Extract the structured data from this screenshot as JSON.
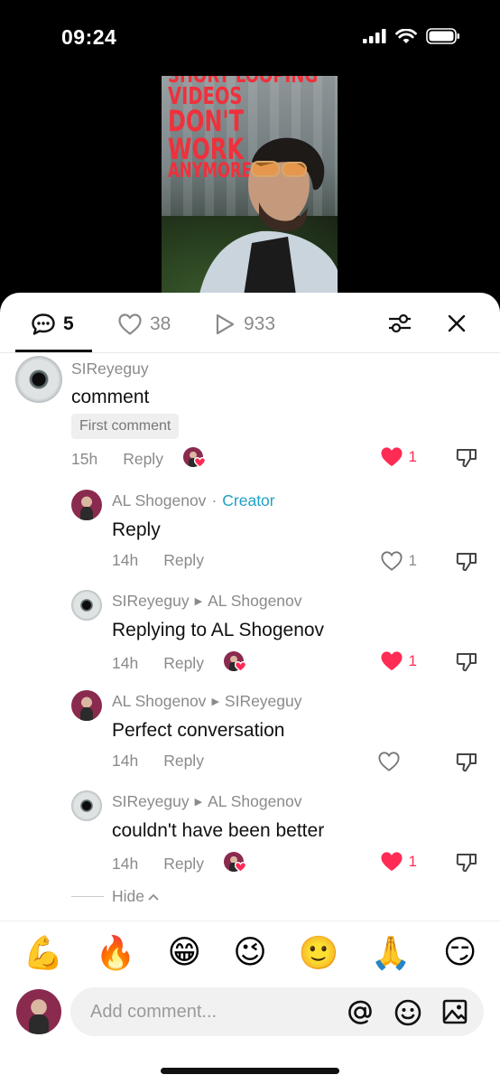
{
  "status_bar": {
    "time": "09:24"
  },
  "video": {
    "title_lines": [
      "SHORT LOOPING",
      "VIDEOS",
      "DON'T",
      "WORK",
      "ANYMORE"
    ]
  },
  "tabs": {
    "comments_count": "5",
    "likes_count": "38",
    "views_count": "933"
  },
  "comments": [
    {
      "author": "SIReyeguy",
      "body": "comment",
      "badge": "First comment",
      "time": "15h",
      "reply_label": "Reply",
      "likes": "1",
      "liked": true,
      "avatar": "eye",
      "creator_liked": true
    },
    {
      "author": "AL Shogenov",
      "creator_label": "Creator",
      "body": "Reply",
      "time": "14h",
      "reply_label": "Reply",
      "likes": "1",
      "liked": false,
      "avatar": "man"
    },
    {
      "author": "SIReyeguy",
      "reply_to": "AL Shogenov",
      "body": "Replying to AL Shogenov",
      "time": "14h",
      "reply_label": "Reply",
      "likes": "1",
      "liked": true,
      "avatar": "eye",
      "creator_liked": true
    },
    {
      "author": "AL Shogenov",
      "reply_to": "SIReyeguy",
      "body": "Perfect conversation",
      "time": "14h",
      "reply_label": "Reply",
      "likes": "",
      "liked": false,
      "avatar": "man"
    },
    {
      "author": "SIReyeguy",
      "reply_to": "AL Shogenov",
      "body": "couldn't have been better",
      "time": "14h",
      "reply_label": "Reply",
      "likes": "1",
      "liked": true,
      "avatar": "eye",
      "creator_liked": true
    }
  ],
  "hide_label": "Hide",
  "emoji_bar": [
    "💪",
    "🔥",
    "😁",
    "😉",
    "🙂",
    "🙏",
    "😏"
  ],
  "input": {
    "placeholder": "Add comment..."
  },
  "colors": {
    "accent_like": "#fe2c55",
    "creator": "#1ea1c6"
  }
}
